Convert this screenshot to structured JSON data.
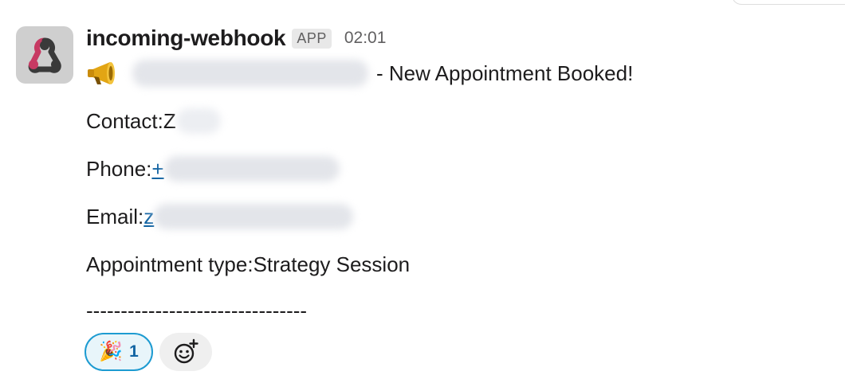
{
  "sender": {
    "name": "incoming-webhook",
    "badge": "APP",
    "time": "02:01"
  },
  "message": {
    "title_suffix": "- New Appointment Booked!",
    "contact_label": "Contact: ",
    "contact_value_visible": "Z",
    "phone_label": "Phone: ",
    "phone_value_visible": "+",
    "email_label": "Email: ",
    "email_value_visible": "z",
    "appointment_label": "Appointment type: ",
    "appointment_value": "Strategy Session",
    "divider": "--------------------------------"
  },
  "reactions": [
    {
      "emoji": "🎉",
      "count": "1"
    }
  ],
  "icons": {
    "avatar": "webhook-icon",
    "megaphone": "megaphone-icon",
    "add_reaction": "add-reaction-icon"
  },
  "colors": {
    "link": "#1264a3",
    "reaction_border": "#1d9bd1",
    "reaction_bg": "#e8f5fa",
    "webhook_pink": "#c73a63"
  }
}
